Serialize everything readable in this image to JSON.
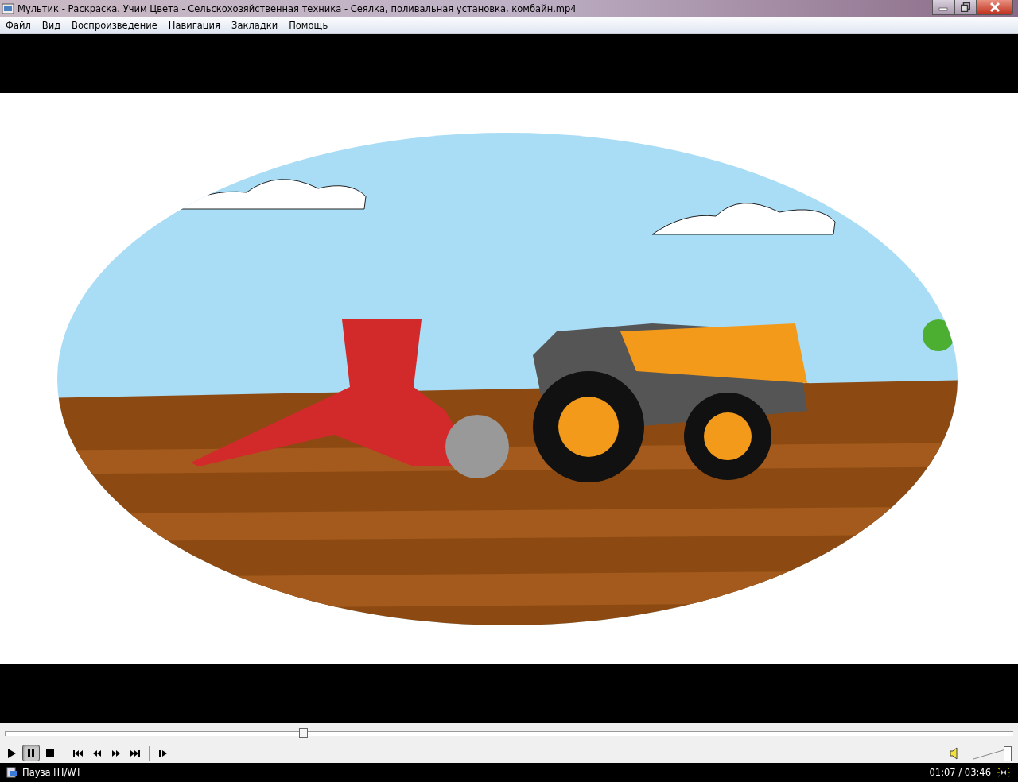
{
  "window": {
    "title": "Мультик - Раскраска. Учим Цвета - Сельскохозяйственная техника - Сеялка, поливальная установка, комбайн.mp4"
  },
  "menu": [
    {
      "label": "Файл"
    },
    {
      "label": "Вид"
    },
    {
      "label": "Воспроизведение"
    },
    {
      "label": "Навигация"
    },
    {
      "label": "Закладки"
    },
    {
      "label": "Помощь"
    }
  ],
  "seek_bar": {
    "level": 0.296
  },
  "controls": [
    {
      "kind": "play",
      "selected": false
    },
    {
      "kind": "pause",
      "selected": true
    },
    {
      "kind": "stop",
      "selected": false
    },
    {
      "kind": "separator"
    },
    {
      "kind": "prev",
      "selected": false
    },
    {
      "kind": "rewind",
      "selected": false
    },
    {
      "kind": "forward",
      "selected": false
    },
    {
      "kind": "next",
      "selected": false
    },
    {
      "kind": "separator"
    },
    {
      "kind": "frame_step",
      "selected": false
    },
    {
      "kind": "separator"
    }
  ],
  "volume": {
    "muted": false,
    "level": 1.0
  },
  "status_bar": {
    "state": "Пауза [H/W]",
    "time": "01:07 / 03:46"
  }
}
